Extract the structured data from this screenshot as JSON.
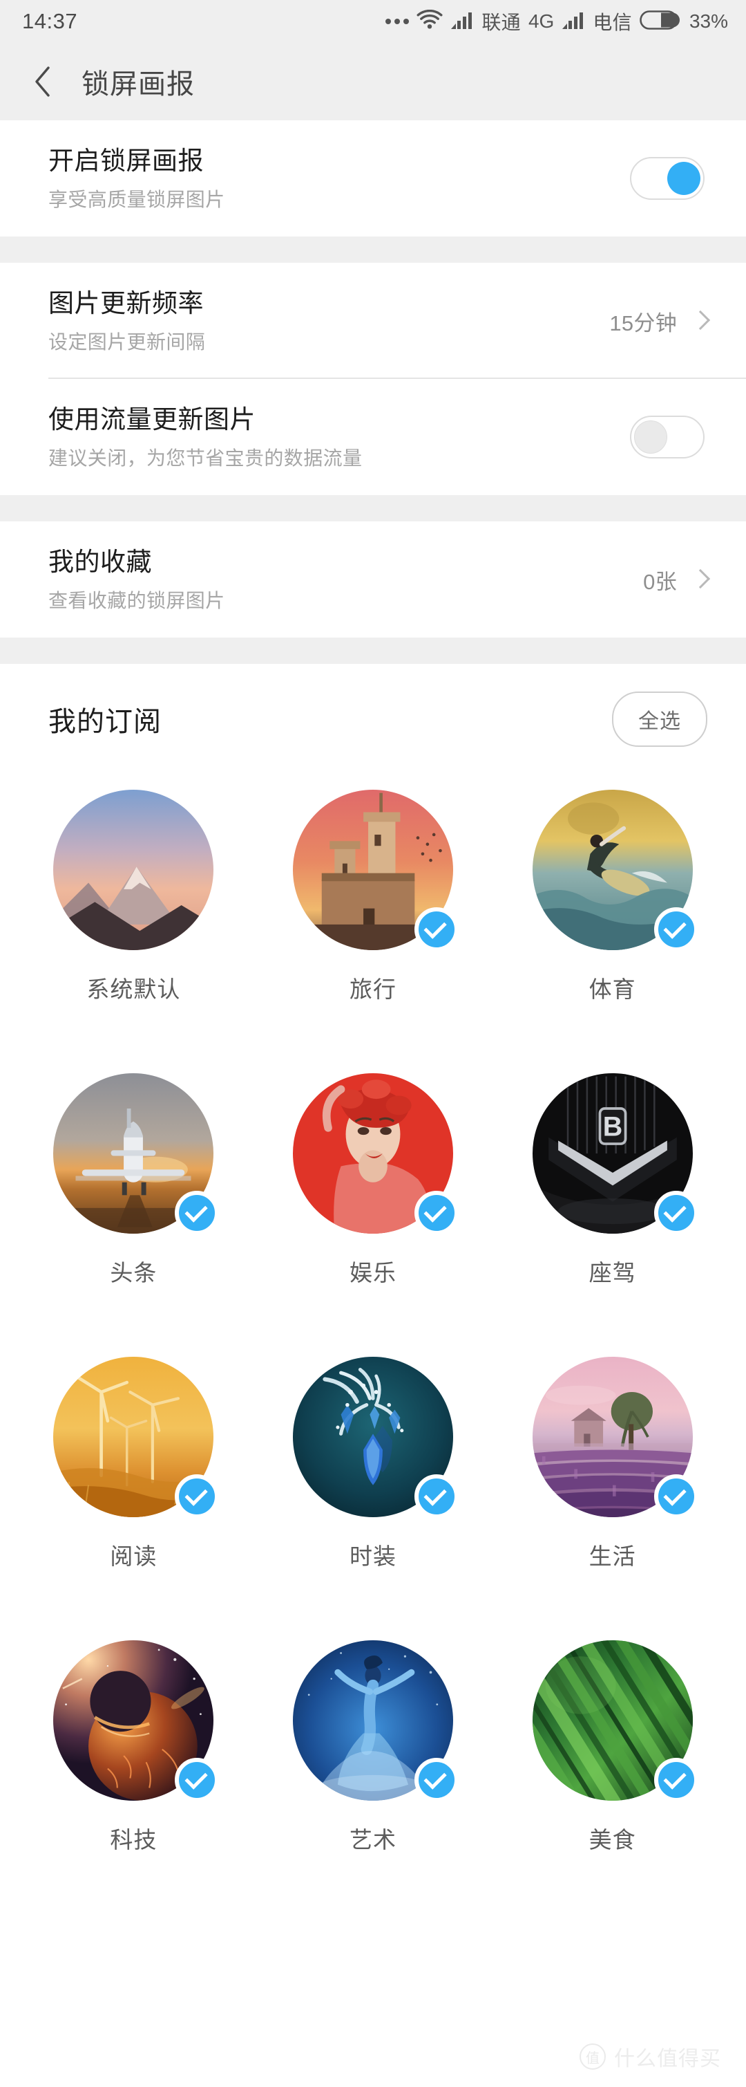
{
  "status_bar": {
    "time": "14:37",
    "icons": [
      "more-dots-icon",
      "wifi-icon",
      "signal-bars-icon",
      "signal-bars-icon",
      "battery-icon"
    ],
    "carrier_1": "联通",
    "network": "4G",
    "carrier_2": "电信",
    "battery_percent": "33%"
  },
  "header": {
    "back_icon": "chevron-left-icon",
    "title": "锁屏画报"
  },
  "settings": {
    "group_1": [
      {
        "title": "开启锁屏画报",
        "subtitle": "享受高质量锁屏图片",
        "control": "toggle",
        "value": "on"
      }
    ],
    "group_2": [
      {
        "title": "图片更新频率",
        "subtitle": "设定图片更新间隔",
        "control": "value-chevron",
        "value": "15分钟"
      },
      {
        "title": "使用流量更新图片",
        "subtitle": "建议关闭，为您节省宝贵的数据流量",
        "control": "toggle",
        "value": "off"
      }
    ],
    "group_3": [
      {
        "title": "我的收藏",
        "subtitle": "查看收藏的锁屏图片",
        "control": "value-chevron",
        "value": "0张"
      }
    ]
  },
  "subscriptions": {
    "section_title": "我的订阅",
    "select_all_label": "全选",
    "items": [
      {
        "label": "系统默认",
        "checked": false,
        "art": "mountain-sunset"
      },
      {
        "label": "旅行",
        "checked": true,
        "art": "castle-sunset"
      },
      {
        "label": "体育",
        "checked": true,
        "art": "surfer-wave"
      },
      {
        "label": "头条",
        "checked": true,
        "art": "jet-runway"
      },
      {
        "label": "娱乐",
        "checked": true,
        "art": "red-portrait"
      },
      {
        "label": "座驾",
        "checked": true,
        "art": "car-grille"
      },
      {
        "label": "阅读",
        "checked": true,
        "art": "windmills-gold"
      },
      {
        "label": "时装",
        "checked": true,
        "art": "blue-jewelry"
      },
      {
        "label": "生活",
        "checked": true,
        "art": "lavender-field"
      },
      {
        "label": "科技",
        "checked": true,
        "art": "space-planets"
      },
      {
        "label": "艺术",
        "checked": true,
        "art": "blue-dancer"
      },
      {
        "label": "美食",
        "checked": true,
        "art": "green-leaves"
      }
    ]
  },
  "watermark": {
    "badge": "值",
    "text": "什么值得买"
  },
  "colors": {
    "accent": "#33aff5",
    "bg": "#efefef",
    "card": "#ffffff",
    "title_text": "#1d1d1d",
    "sub_text": "#a6a6a6"
  }
}
